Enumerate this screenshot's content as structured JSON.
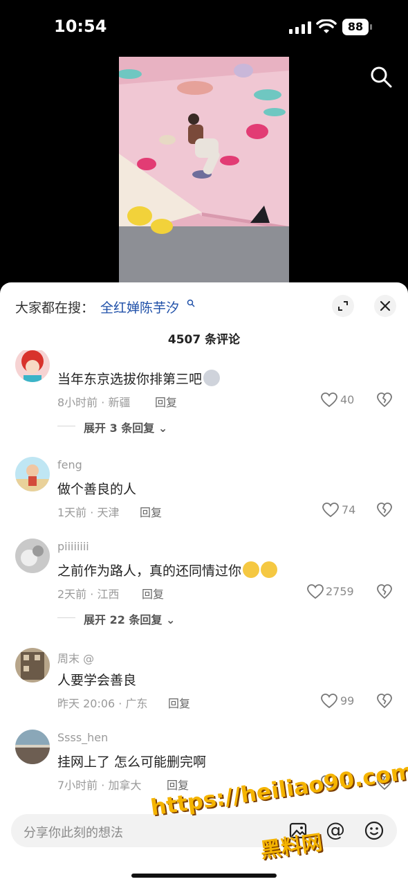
{
  "status": {
    "time": "10:54",
    "battery": "88"
  },
  "hot_search": {
    "label": "大家都在搜：",
    "term": "全红婵陈芋汐"
  },
  "comment_count_title": "4507 条评论",
  "comments": [
    {
      "username": "",
      "content": "当年东京选拔你排第三吧",
      "meta": "8小时前 · 新疆",
      "reply": "回复",
      "likes": "40",
      "expand": "展开 3 条回复"
    },
    {
      "username": "feng",
      "content": "做个善良的人",
      "meta": "1天前 · 天津",
      "reply": "回复",
      "likes": "74",
      "expand": ""
    },
    {
      "username": "piiiiiiii",
      "content": "之前作为路人，真的还同情过你",
      "meta": "2天前 · 江西",
      "reply": "回复",
      "likes": "2759",
      "expand": "展开 22 条回复"
    },
    {
      "username": "周末 @",
      "content": "人要学会善良",
      "meta": "昨天 20:06 · 广东",
      "reply": "回复",
      "likes": "99",
      "expand": ""
    },
    {
      "username": "Ssss_hen",
      "content": "挂网上了 怎么可能删完啊",
      "meta": "7小时前 · 加拿大",
      "reply": "回复",
      "likes": "34",
      "expand": ""
    }
  ],
  "input": {
    "placeholder": "分享你此刻的想法"
  },
  "watermark": {
    "line1": "https://heiliao90.com",
    "line2": "黑料网"
  },
  "colors": {
    "link": "#1e4fa8",
    "sheet": "#ffffff",
    "background": "#000000"
  },
  "icons": [
    "search-icon",
    "expand-icon",
    "close-icon",
    "heart-icon",
    "broken-heart-icon",
    "image-icon",
    "at-icon",
    "emoji-icon"
  ]
}
